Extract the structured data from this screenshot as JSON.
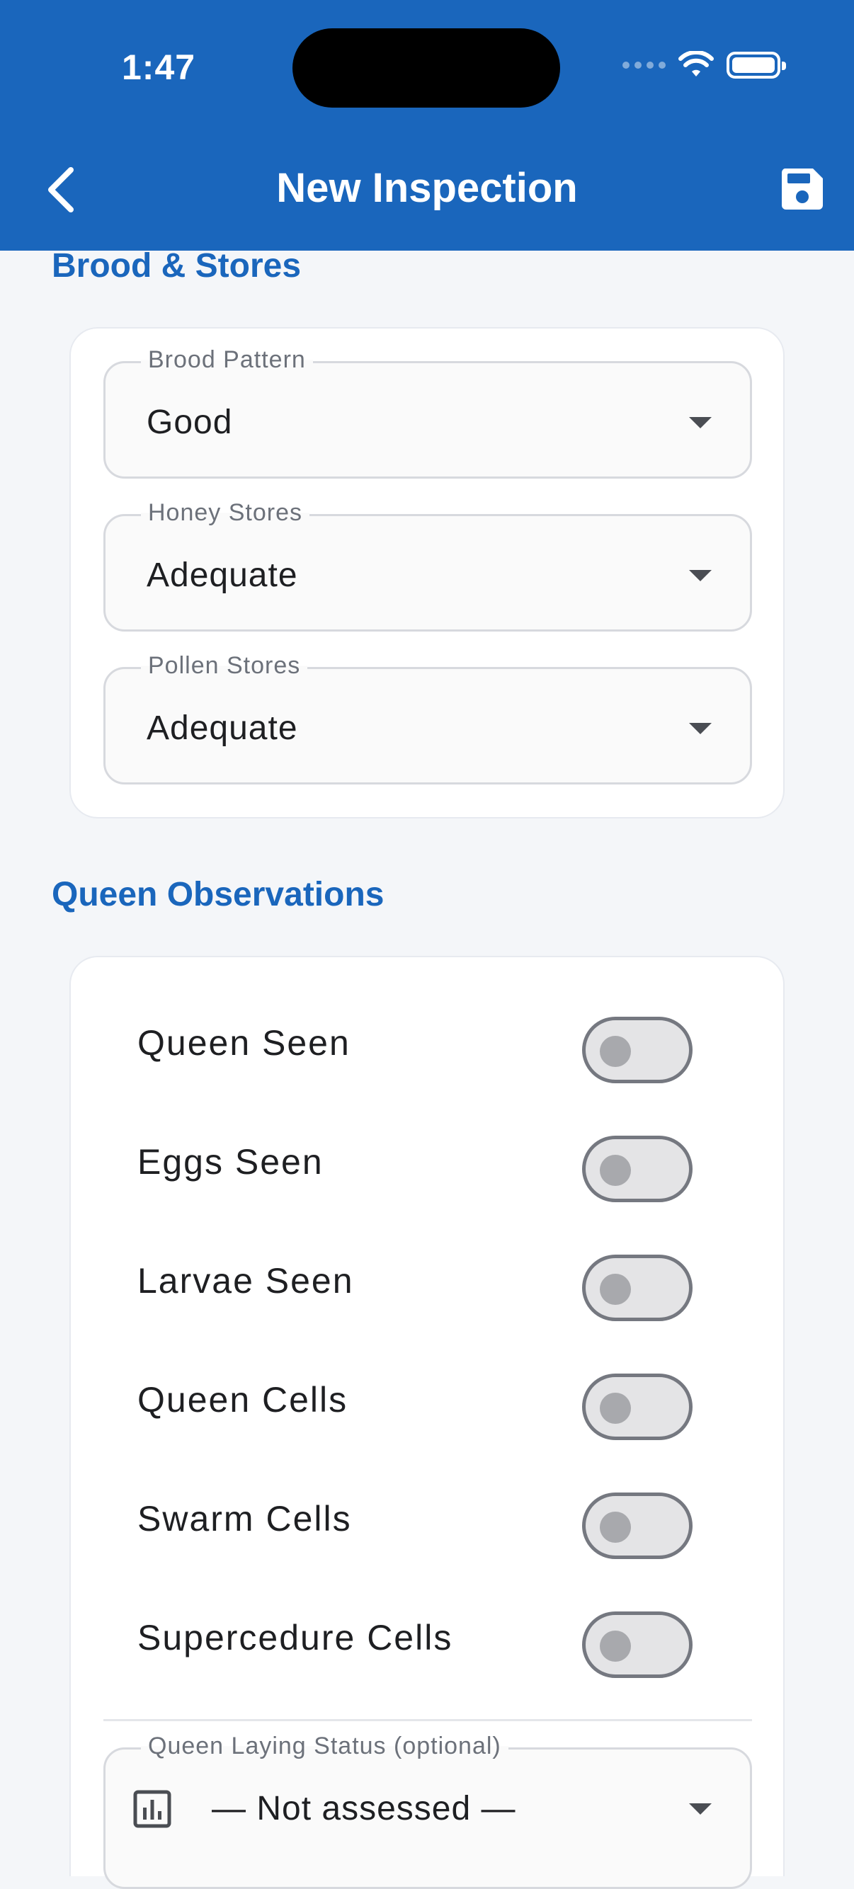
{
  "status_bar": {
    "time": "1:47"
  },
  "app_bar": {
    "title": "New Inspection",
    "back_icon": "chevron-left-icon",
    "save_icon": "save-icon"
  },
  "brood_section": {
    "title": "Brood & Stores",
    "fields": [
      {
        "label": "Brood Pattern",
        "value": "Good"
      },
      {
        "label": "Honey Stores",
        "value": "Adequate"
      },
      {
        "label": "Pollen Stores",
        "value": "Adequate"
      }
    ]
  },
  "queen_section": {
    "title": "Queen Observations",
    "toggles": [
      {
        "label": "Queen Seen",
        "on": false
      },
      {
        "label": "Eggs Seen",
        "on": false
      },
      {
        "label": "Larvae Seen",
        "on": false
      },
      {
        "label": "Queen Cells",
        "on": false
      },
      {
        "label": "Swarm Cells",
        "on": false
      },
      {
        "label": "Supercedure Cells",
        "on": false
      }
    ],
    "laying_status": {
      "label": "Queen Laying Status (optional)",
      "value": "— Not assessed —",
      "icon": "bar-chart-icon"
    }
  },
  "colors": {
    "primary": "#1A66BC",
    "background": "#F4F6F9"
  }
}
